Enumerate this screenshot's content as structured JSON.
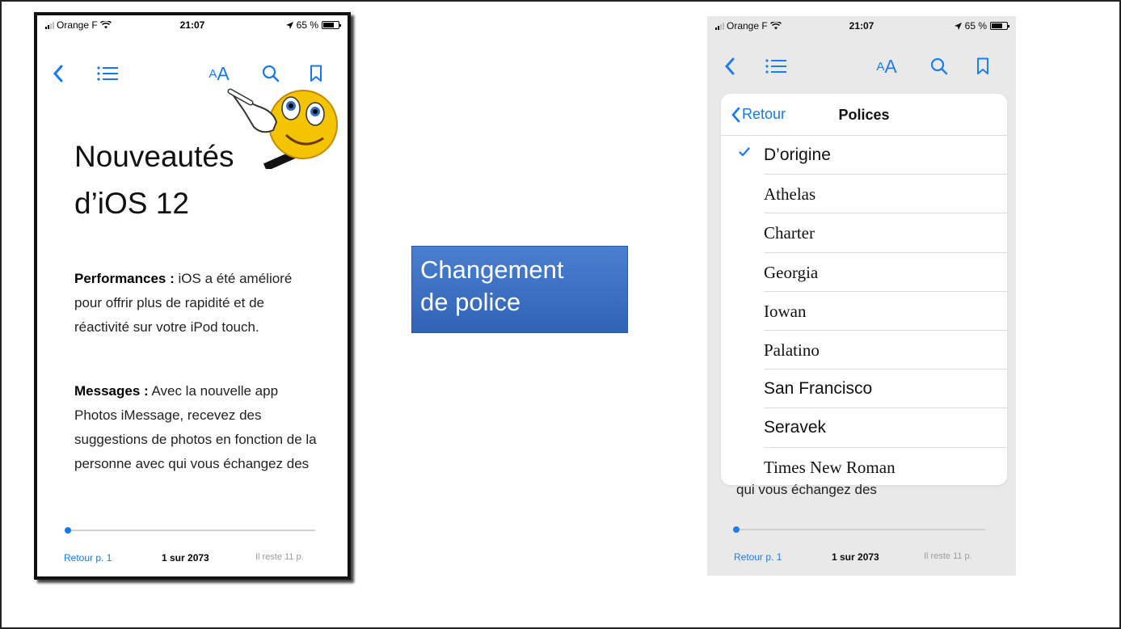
{
  "colors": {
    "accent": "#1478f0",
    "label_bg": "#3a6fc4"
  },
  "status": {
    "carrier": "Orange F",
    "time": "21:07",
    "battery": "65 %"
  },
  "left_phone": {
    "title_line1": "Nouveautés",
    "title_line2": "d’iOS 12",
    "para1_bold": "Performances :",
    "para1_text": " iOS a été amélioré pour offrir plus de rapidité et de réactivité sur votre iPod touch.",
    "para2_bold": "Messages :",
    "para2_text": " Avec la nouvelle app Photos iMessage, recevez des suggestions de photos en fonction de la personne avec qui vous échangez des"
  },
  "toolbar": {
    "back_icon": "chevron-left-icon",
    "toc_icon": "list-icon",
    "font_icon_label": "AA",
    "search_icon": "search-icon",
    "bookmark_icon": "bookmark-icon"
  },
  "footer": {
    "back_label": "Retour p. 1",
    "page_label": "1 sur 2073",
    "remaining_label": "Il reste 11 p.",
    "progress_fraction": 0.0
  },
  "label_box": {
    "line1": "Changement",
    "line2": "de police"
  },
  "fonts_popup": {
    "back_label": "Retour",
    "title": "Polices",
    "items": [
      "D’origine",
      "Athelas",
      "Charter",
      "Georgia",
      "Iowan",
      "Palatino",
      "San Francisco",
      "Seravek",
      "Times New Roman"
    ],
    "selected_index": 0
  },
  "right_phone": {
    "behind_text": "qui vous échangez des"
  }
}
